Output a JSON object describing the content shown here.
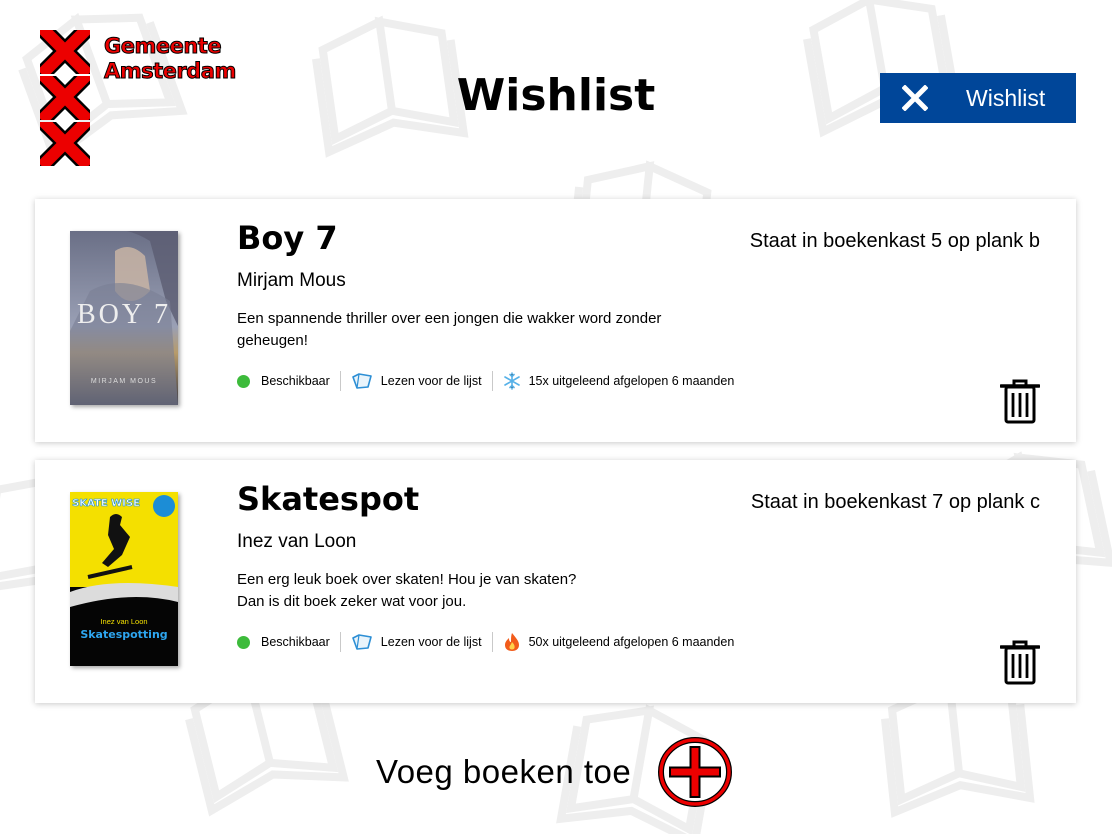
{
  "header": {
    "logo_line1": "Gemeente",
    "logo_line2": "Amsterdam",
    "page_title": "Wishlist",
    "wishlist_button_label": "Wishlist"
  },
  "books": [
    {
      "title": "Boy 7",
      "author": "Mirjam Mous",
      "description_line1": "Een spannende thriller over een jongen die wakker word zonder",
      "description_line2": "geheugen!",
      "location": "Staat in boekenkast 5 op plank b",
      "availability": "Beschikbaar",
      "list_status": "Lezen voor de lijst",
      "loan_stat": "15x uitgeleend afgelopen 6 maanden",
      "popularity_icon": "snowflake-icon",
      "cover_text": "BOY 7",
      "cover_author": "MIRJAM MOUS"
    },
    {
      "title": "Skatespot",
      "author": "Inez van Loon",
      "description_line1": "Een erg leuk boek over skaten! Hou je van skaten?",
      "description_line2": "Dan is dit boek zeker wat voor jou.",
      "location": "Staat in boekenkast 7 op plank c",
      "availability": "Beschikbaar",
      "list_status": "Lezen voor de lijst",
      "loan_stat": "50x uitgeleend afgelopen 6 maanden",
      "popularity_icon": "flame-icon",
      "cover_text": "Skatespotting",
      "cover_author": "Inez van Loon",
      "cover_series": "SKATE WISE"
    }
  ],
  "footer": {
    "add_label": "Voeg boeken toe"
  },
  "colors": {
    "brand_red": "#ec0000",
    "button_blue": "#004699",
    "available_green": "#3dbb3b"
  }
}
